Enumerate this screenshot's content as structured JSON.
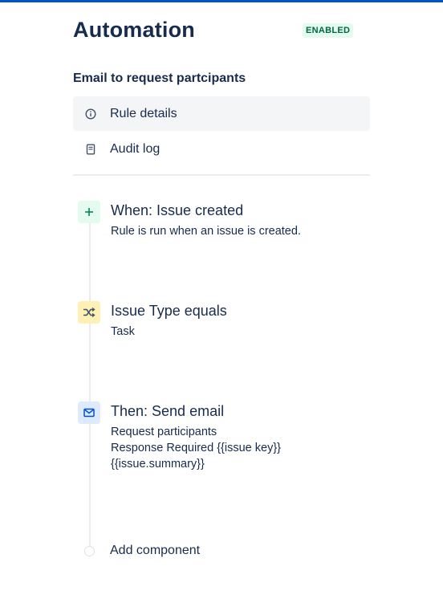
{
  "header": {
    "title": "Automation",
    "status_badge": "ENABLED"
  },
  "rule": {
    "name": "Email to request partcipants"
  },
  "nav": {
    "items": [
      {
        "label": "Rule details",
        "icon": "info-icon",
        "active": true
      },
      {
        "label": "Audit log",
        "icon": "document-icon",
        "active": false
      }
    ]
  },
  "steps": [
    {
      "title": "When: Issue created",
      "description": "Rule is run when an issue is created.",
      "icon": "plus-icon",
      "color": "#e3fcef"
    },
    {
      "title": "Issue Type equals",
      "description": "Task",
      "icon": "shuffle-icon",
      "color": "#fff0b3"
    },
    {
      "title": "Then: Send email",
      "description_lines": [
        "Request participants",
        "Response Required {{issue key}}",
        "{{issue.summary}}"
      ],
      "icon": "envelope-icon",
      "color": "#deebff"
    }
  ],
  "add_component": {
    "label": "Add component"
  },
  "colors": {
    "accent": "#0052cc",
    "enabled_bg": "#e3fcef",
    "enabled_text": "#006644"
  }
}
